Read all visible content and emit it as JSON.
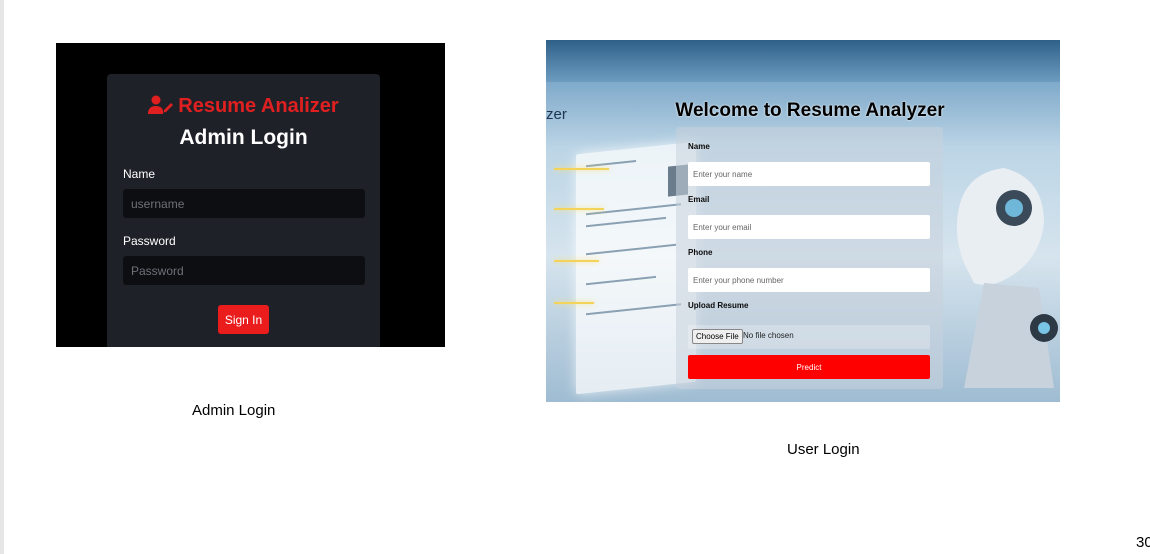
{
  "admin": {
    "brand": "Resume Analizer",
    "title": "Admin Login",
    "name_label": "Name",
    "name_placeholder": "username",
    "password_label": "Password",
    "password_placeholder": "Password",
    "signin_label": "Sign In",
    "brand_color": "#e02020",
    "button_color": "#ea1c1c"
  },
  "user": {
    "bg_text": "zer",
    "title": "Welcome to Resume Analyzer",
    "name_label": "Name",
    "name_placeholder": "Enter your name",
    "email_label": "Email",
    "email_placeholder": "Enter your email",
    "phone_label": "Phone",
    "phone_placeholder": "Enter your phone number",
    "upload_label": "Upload Resume",
    "choose_file_label": "Choose File",
    "no_file_text": "No file chosen",
    "predict_label": "Predict",
    "button_color": "#ff0000"
  },
  "captions": {
    "admin": "Admin Login",
    "user": "User Login"
  },
  "page_number": "30",
  "icons": {
    "brand_icon": "user-edit-icon"
  }
}
